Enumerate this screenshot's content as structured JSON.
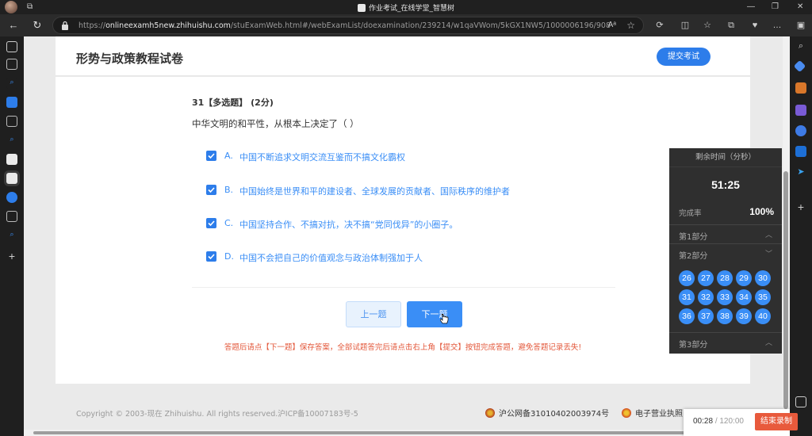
{
  "window": {
    "title": "作业考试_在线学堂_智慧树",
    "controls": [
      "minimize-icon",
      "restore-icon",
      "close-icon"
    ]
  },
  "browser": {
    "url_prefix": "https://",
    "url_host": "onlineexamh5new.zhihuishu.com",
    "url_path": "/stuExamWeb.html#/webExamList/doexamination/239214/w1qaVWom/5kGX1NW5/1000006196/908"
  },
  "exam": {
    "title": "形势与政策教程试卷",
    "submit_label": "提交考试"
  },
  "question": {
    "header": "31【多选题】 (2分)",
    "text": "中华文明的和平性，从根本上决定了（ ）",
    "options": [
      {
        "letter": "A.",
        "text": "中国不断追求文明交流互鉴而不搞文化霸权",
        "checked": true
      },
      {
        "letter": "B.",
        "text": "中国始终是世界和平的建设者、全球发展的贡献者、国际秩序的维护者",
        "checked": true
      },
      {
        "letter": "C.",
        "text": "中国坚持合作、不搞对抗，决不搞“党同伐异”的小圈子。",
        "checked": true
      },
      {
        "letter": "D.",
        "text": "中国不会把自己的价值观念与政治体制强加于人",
        "checked": true
      }
    ]
  },
  "nav": {
    "prev_label": "上一题",
    "next_label": "下一题",
    "warning": "答题后请点【下一题】保存答案，全部试题答完后请点击右上角【提交】按钮完成答题，避免答题记录丢失!"
  },
  "panel": {
    "time_label": "剩余时间（分秒）",
    "time_value": "51:25",
    "rate_label": "完成率",
    "rate_value": "100%",
    "sections": [
      {
        "label": "第1部分",
        "expanded": false
      },
      {
        "label": "第2部分",
        "expanded": true
      },
      {
        "label": "第3部分",
        "expanded": false
      }
    ],
    "numbers": [
      "26",
      "27",
      "28",
      "29",
      "30",
      "31",
      "32",
      "33",
      "34",
      "35",
      "36",
      "37",
      "38",
      "39",
      "40"
    ]
  },
  "footer": {
    "copyright": "Copyright © 2003-现在 Zhihuishu. All rights reserved.沪ICP备10007183号-5",
    "beian": "沪公网备31010402003974号",
    "biz_license": "电子营业执照"
  },
  "recording": {
    "elapsed": "00:28",
    "total": "/ 120:00",
    "end_label": "结束录制"
  },
  "colors": {
    "accent": "#2d7dea",
    "option_text": "#3a8ef6",
    "warning": "#e3583b",
    "panel_bg": "#2f2f2f",
    "rec_button": "#e85a3c"
  }
}
